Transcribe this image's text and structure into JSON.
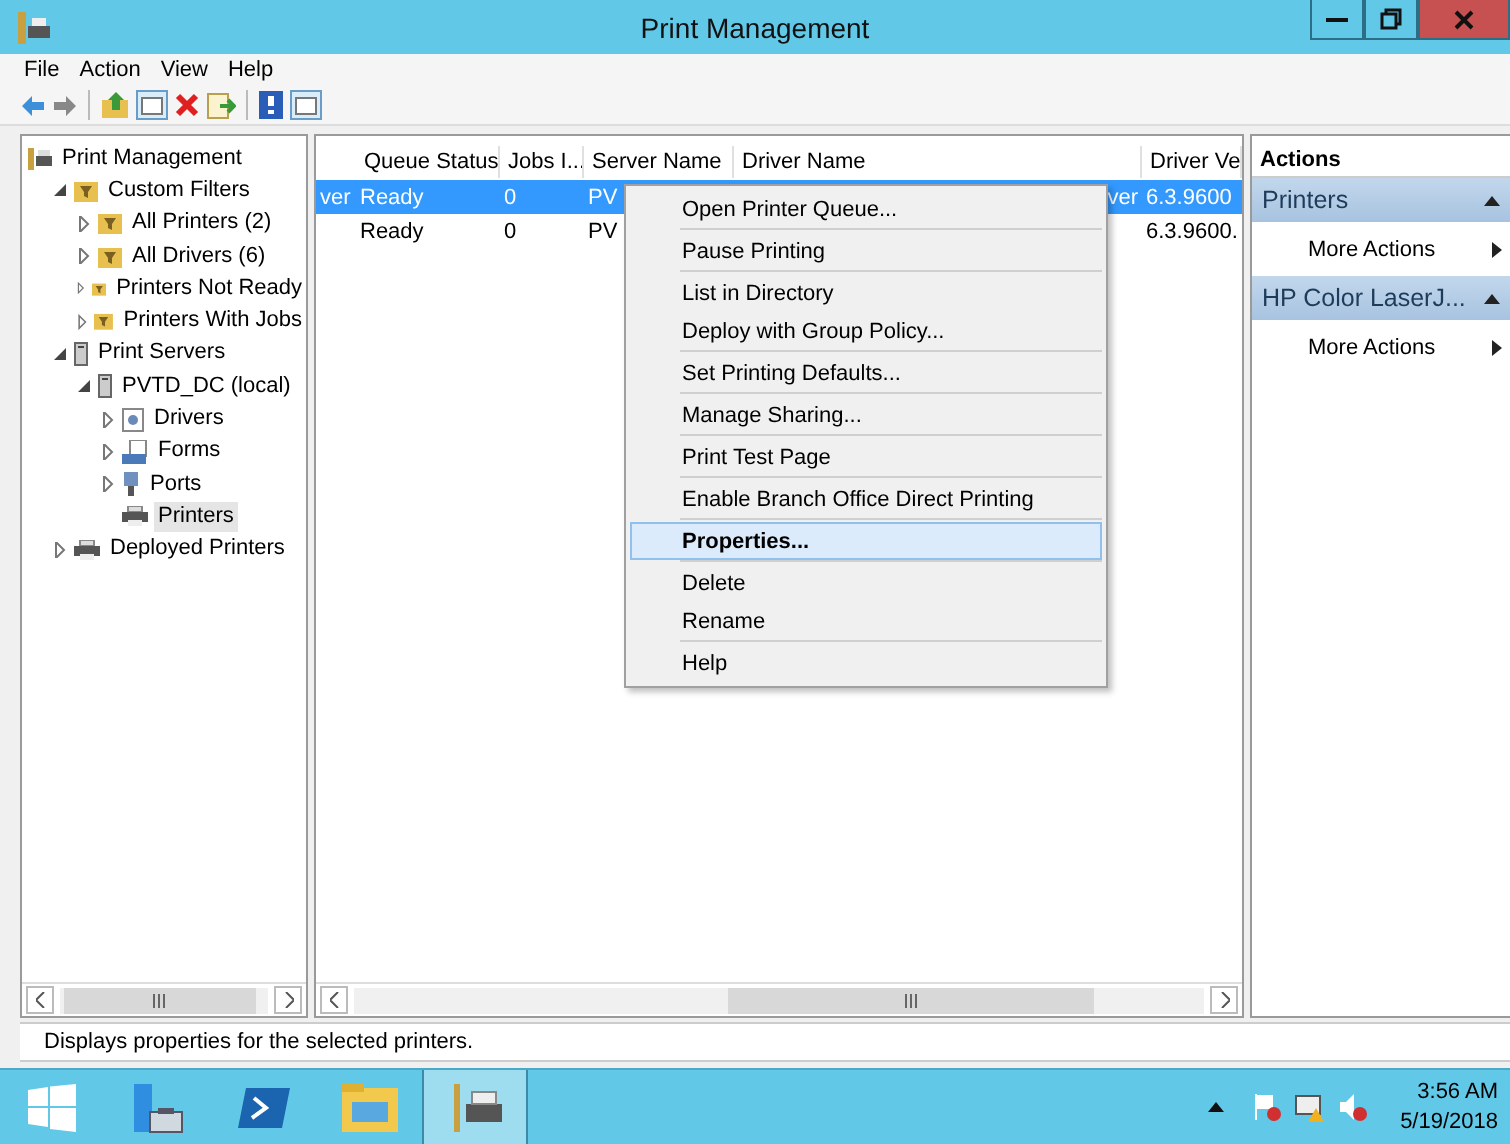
{
  "window": {
    "title": "Print Management"
  },
  "menu": [
    "File",
    "Action",
    "View",
    "Help"
  ],
  "toolbar": [
    {
      "kind": "back"
    },
    {
      "kind": "forward"
    },
    {
      "kind": "sep"
    },
    {
      "kind": "up"
    },
    {
      "kind": "pane"
    },
    {
      "kind": "delete"
    },
    {
      "kind": "export"
    },
    {
      "kind": "sep"
    },
    {
      "kind": "help"
    },
    {
      "kind": "pane"
    }
  ],
  "tree": [
    {
      "label": "Print Management",
      "kind": "root",
      "selected": false,
      "children": [
        {
          "label": "Custom Filters",
          "kind": "filter",
          "expanded": true,
          "selected": false,
          "children": [
            {
              "label": "All Printers (2)",
              "kind": "filter",
              "expanded": false,
              "selected": false
            },
            {
              "label": "All Drivers (6)",
              "kind": "filter",
              "expanded": false,
              "selected": false
            },
            {
              "label": "Printers Not Ready",
              "kind": "filter",
              "expanded": false,
              "selected": false
            },
            {
              "label": "Printers With Jobs",
              "kind": "filter",
              "expanded": false,
              "selected": false
            }
          ]
        },
        {
          "label": "Print Servers",
          "kind": "server",
          "expanded": true,
          "selected": false,
          "children": [
            {
              "label": "PVTD_DC (local)",
              "kind": "server",
              "expanded": true,
              "selected": false,
              "children": [
                {
                  "label": "Drivers",
                  "kind": "drivers",
                  "expanded": false,
                  "selected": false
                },
                {
                  "label": "Forms",
                  "kind": "forms",
                  "expanded": false,
                  "selected": false
                },
                {
                  "label": "Ports",
                  "kind": "ports",
                  "expanded": false,
                  "selected": false
                },
                {
                  "label": "Printers",
                  "kind": "printer",
                  "selected": true
                }
              ]
            }
          ]
        },
        {
          "label": "Deployed Printers",
          "kind": "printer",
          "expanded": false,
          "selected": false
        }
      ]
    }
  ],
  "table": {
    "columns": [
      "",
      "Queue Status",
      "Jobs I...",
      "Server Name",
      "Driver Name",
      "Driver Ve"
    ],
    "rows": [
      {
        "selected": true,
        "cells": [
          "ver",
          "Ready",
          "0",
          "PV",
          "ver",
          "6.3.9600"
        ]
      },
      {
        "selected": false,
        "cells": [
          "",
          "Ready",
          "0",
          "PV",
          "",
          "6.3.9600."
        ]
      }
    ]
  },
  "context_menu": [
    {
      "label": "Open Printer Queue...",
      "separator_before": false,
      "selected": false,
      "bold": false
    },
    {
      "label": "Pause Printing",
      "separator_before": true,
      "selected": false,
      "bold": false
    },
    {
      "label": "List in Directory",
      "separator_before": true,
      "selected": false,
      "bold": false
    },
    {
      "label": "Deploy with Group Policy...",
      "separator_before": false,
      "selected": false,
      "bold": false
    },
    {
      "label": "Set Printing Defaults...",
      "separator_before": true,
      "selected": false,
      "bold": false
    },
    {
      "label": "Manage Sharing...",
      "separator_before": true,
      "selected": false,
      "bold": false
    },
    {
      "label": "Print Test Page",
      "separator_before": true,
      "selected": false,
      "bold": false
    },
    {
      "label": "Enable Branch Office Direct Printing",
      "separator_before": true,
      "selected": false,
      "bold": false
    },
    {
      "label": "Properties...",
      "separator_before": true,
      "selected": true,
      "bold": true
    },
    {
      "label": "Delete",
      "separator_before": true,
      "selected": false,
      "bold": false
    },
    {
      "label": "Rename",
      "separator_before": false,
      "selected": false,
      "bold": false
    },
    {
      "label": "Help",
      "separator_before": true,
      "selected": false,
      "bold": false
    }
  ],
  "actions": {
    "title": "Actions",
    "sections": [
      {
        "title": "Printers",
        "items": [
          "More Actions"
        ]
      },
      {
        "title": "HP Color LaserJ...",
        "items": [
          "More Actions"
        ]
      }
    ]
  },
  "status_bar": "Displays properties for the selected printers.",
  "taskbar": {
    "apps": [
      {
        "kind": "server-manager",
        "selected": false
      },
      {
        "kind": "powershell",
        "selected": false
      },
      {
        "kind": "explorer",
        "selected": false
      },
      {
        "kind": "print",
        "selected": true
      }
    ],
    "tray": [
      {
        "kind": "flag"
      },
      {
        "kind": "network"
      },
      {
        "kind": "speaker"
      }
    ],
    "time": "3:56 AM",
    "date": "5/19/2018"
  }
}
